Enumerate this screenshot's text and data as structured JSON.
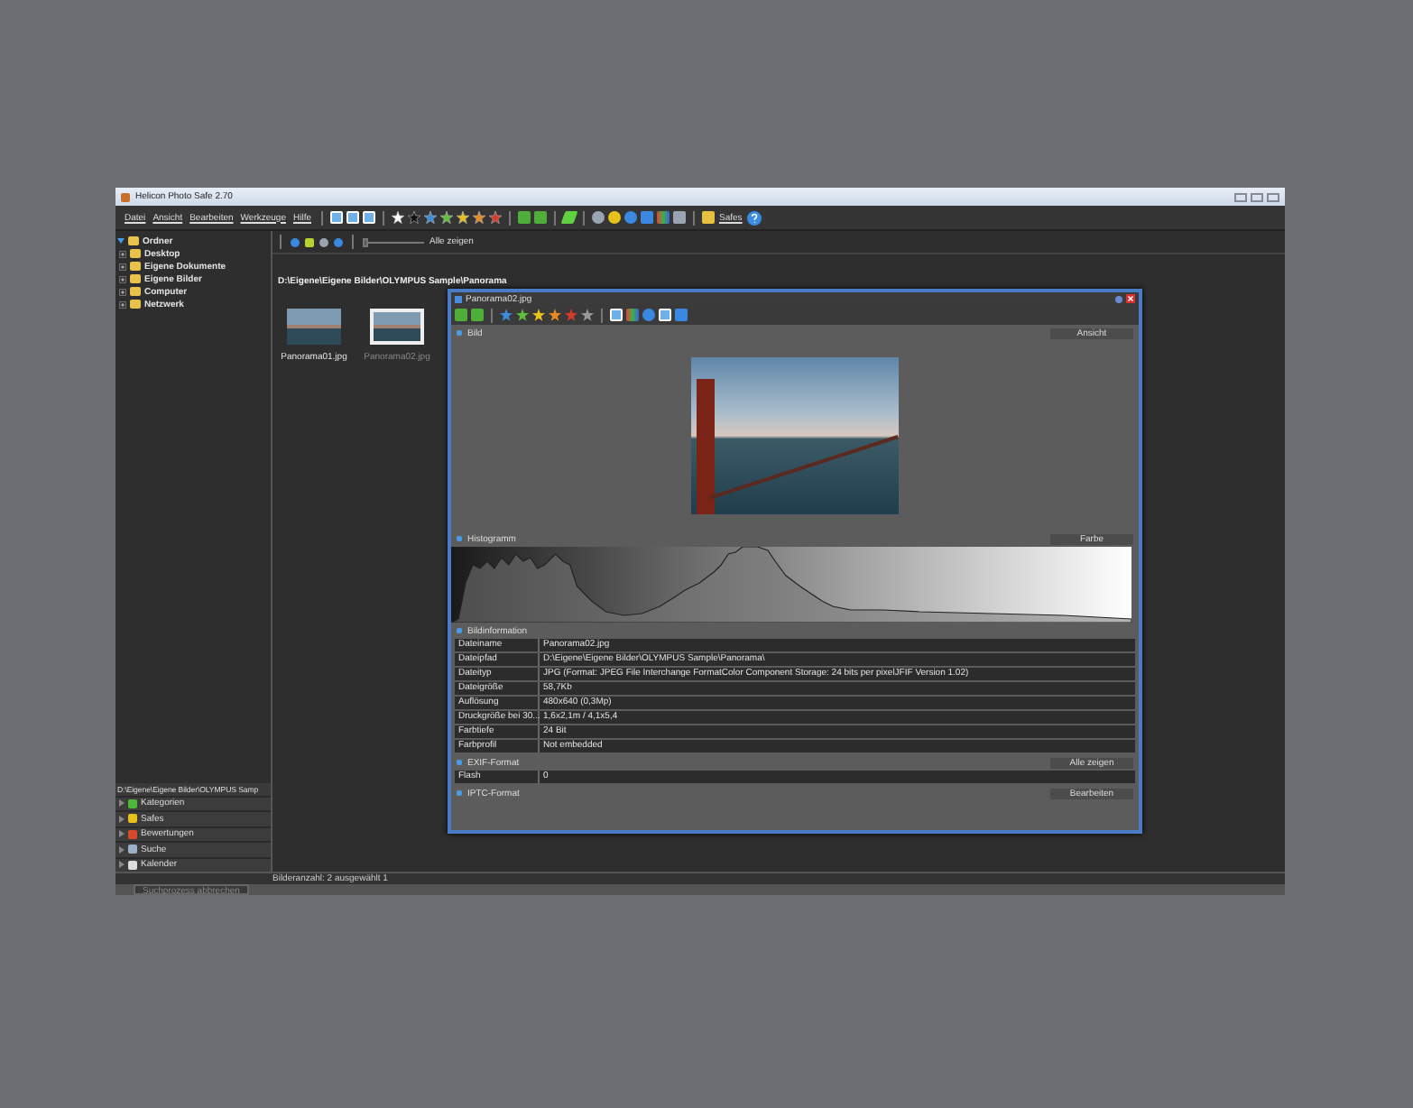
{
  "window": {
    "title": "Helicon Photo Safe 2.70"
  },
  "menu": [
    "Datei",
    "Ansicht",
    "Bearbeiten",
    "Werkzeuge",
    "Hilfe"
  ],
  "toolbar": {
    "safes_label": "Safes"
  },
  "folder_tree": [
    {
      "label": "Ordner",
      "expanded": true,
      "children": [
        {
          "label": "Desktop",
          "expanded": false
        },
        {
          "label": "Eigene Dokumente",
          "expanded": false
        },
        {
          "label": "Eigene Bilder",
          "expanded": false
        },
        {
          "label": "Computer",
          "expanded": false
        },
        {
          "label": "Netzwerk",
          "expanded": false
        }
      ]
    }
  ],
  "left_panel": {
    "path": "D:\\Eigene\\Eigene Bilder\\OLYMPUS Samp",
    "panels": [
      {
        "label": "Kategorien"
      },
      {
        "label": "Safes"
      },
      {
        "label": "Bewertungen"
      },
      {
        "label": "Suche"
      },
      {
        "label": "Kalender"
      }
    ]
  },
  "browser": {
    "zoom": {
      "level": 0
    },
    "filter": "Alle zeigen",
    "path": "D:\\Eigene\\Eigene Bilder\\OLYMPUS Sample\\Panorama",
    "thumbnails": [
      {
        "name": "Panorama01.jpg",
        "selected": false
      },
      {
        "name": "Panorama02.jpg",
        "selected": true
      }
    ]
  },
  "status_bar": {
    "text": "Bilderanzahl: 2 ausgewählt 1",
    "cancel_button": {
      "label": "Suchprozess abbrechen",
      "disabled": true
    }
  },
  "dialog": {
    "title": "Panorama02.jpg",
    "image_section": {
      "title": "Bild",
      "button": "Ansicht"
    },
    "histogram_section": {
      "title": "Histogramm",
      "button": "Farbe"
    },
    "info_section": {
      "title": "Bildinformation",
      "rows": [
        {
          "key": "Dateiname",
          "value": "Panorama02.jpg"
        },
        {
          "key": "Dateipfad",
          "value": "D:\\Eigene\\Eigene Bilder\\OLYMPUS Sample\\Panorama\\"
        },
        {
          "key": "Dateityp",
          "value": "JPG (Format: JPEG File Interchange FormatColor Component Storage: 24 bits per pixelJFIF Version 1.02)"
        },
        {
          "key": "Dateigröße",
          "value": "58,7Kb"
        },
        {
          "key": "Auflösung",
          "value": "480x640 (0,3Mp)"
        },
        {
          "key": "Druckgröße bei 30...",
          "value": "1,6x2,1m / 4,1x5,4"
        },
        {
          "key": "Farbtiefe",
          "value": "24 Bit"
        },
        {
          "key": "Farbprofil",
          "value": "Not embedded"
        }
      ]
    },
    "exif_section": {
      "title": "EXIF-Format",
      "button": "Alle zeigen",
      "rows": [
        {
          "key": "Flash",
          "value": "0"
        }
      ]
    },
    "iptc_section": {
      "title": "IPTC-Format",
      "button": "Bearbeiten"
    }
  }
}
